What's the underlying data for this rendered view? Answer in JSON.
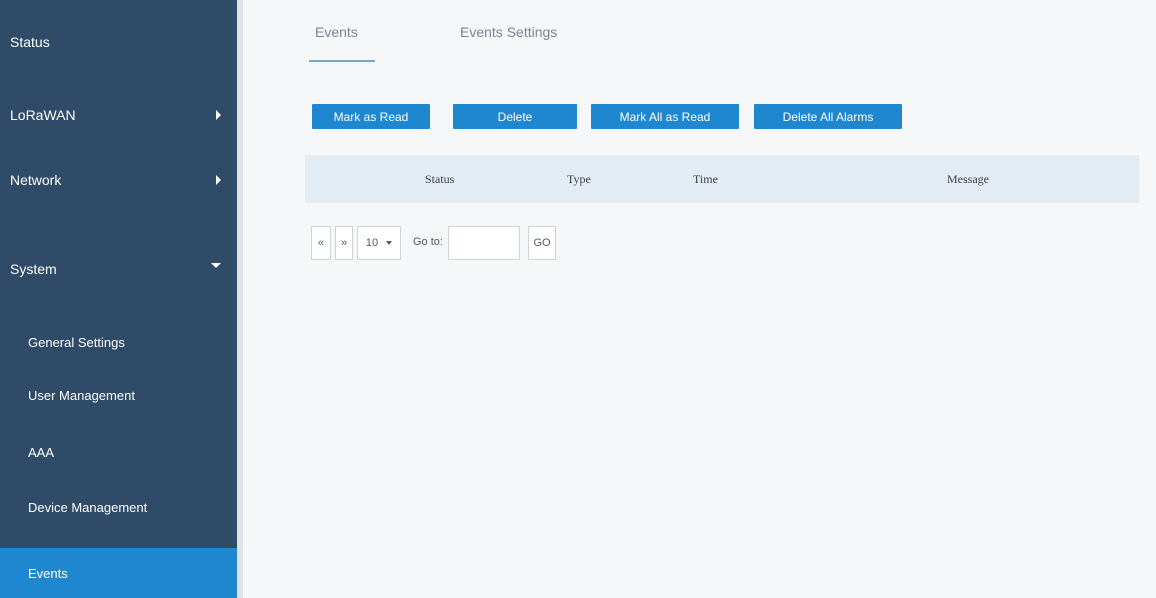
{
  "sidebar": {
    "items": [
      {
        "label": "Status"
      },
      {
        "label": "LoRaWAN"
      },
      {
        "label": "Network"
      },
      {
        "label": "System"
      }
    ],
    "subitems": [
      {
        "label": "General Settings"
      },
      {
        "label": "User Management"
      },
      {
        "label": "AAA"
      },
      {
        "label": "Device Management"
      },
      {
        "label": "Events"
      }
    ]
  },
  "tabs": [
    {
      "label": "Events"
    },
    {
      "label": "Events Settings"
    }
  ],
  "toolbar": {
    "mark_read": "Mark as Read",
    "delete": "Delete",
    "mark_all_read": "Mark All as Read",
    "delete_all": "Delete All Alarms"
  },
  "table": {
    "columns": [
      "Status",
      "Type",
      "Time",
      "Message"
    ]
  },
  "pager": {
    "prev": "«",
    "next": "»",
    "page_size": "10",
    "goto_label": "Go to:",
    "goto_value": "",
    "go_button": "GO"
  },
  "colors": {
    "sidebar_bg": "#2f4b67",
    "accent": "#1f87d0",
    "table_header_bg": "#e3ebf3"
  }
}
